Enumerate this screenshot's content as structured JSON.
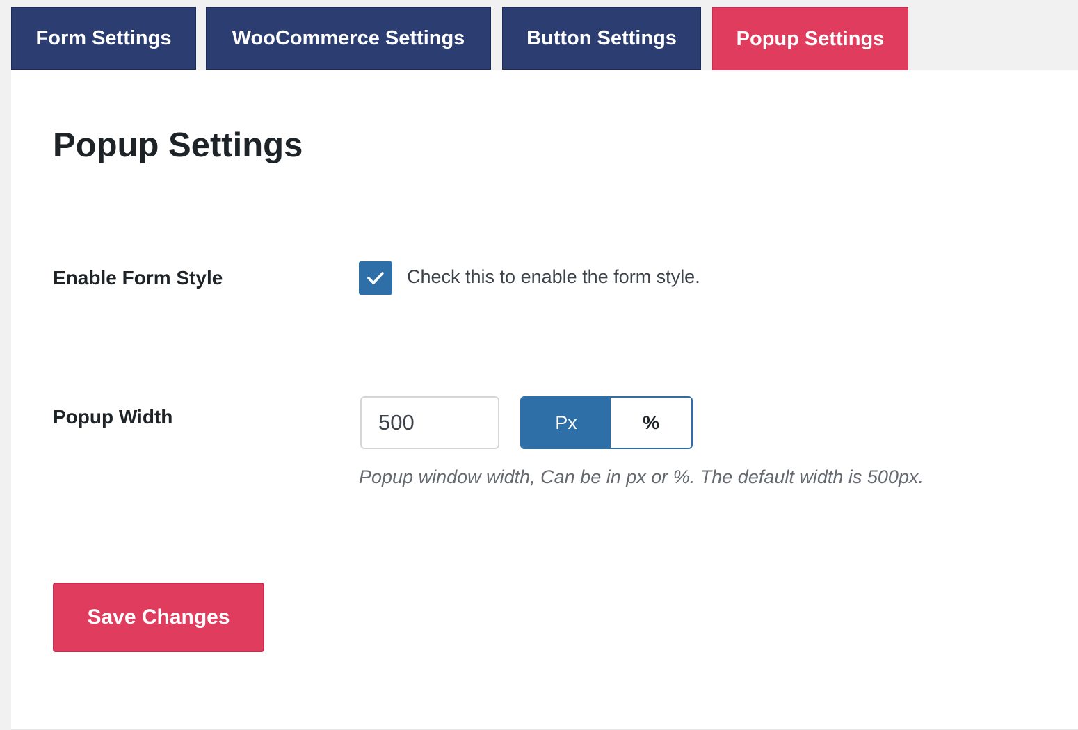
{
  "tabs": [
    {
      "label": "Form Settings",
      "active": false
    },
    {
      "label": "WooCommerce Settings",
      "active": false
    },
    {
      "label": "Button Settings",
      "active": false
    },
    {
      "label": "Popup Settings",
      "active": true
    }
  ],
  "panel": {
    "title": "Popup Settings",
    "enable_form_style": {
      "label": "Enable Form Style",
      "checked": true,
      "description": "Check this to enable the form style."
    },
    "popup_width": {
      "label": "Popup Width",
      "value": "500",
      "units": [
        "Px",
        "%"
      ],
      "selected_unit": "Px",
      "description": "Popup window width, Can be in px or %. The default width is 500px."
    },
    "save_label": "Save Changes"
  },
  "colors": {
    "tab_background": "#2c3e71",
    "active_tab_background": "#e03d5e",
    "checkbox_blue": "#2f6fa8",
    "save_button": "#e03d5e",
    "page_background": "#f1f1f1",
    "panel_background": "#ffffff"
  }
}
